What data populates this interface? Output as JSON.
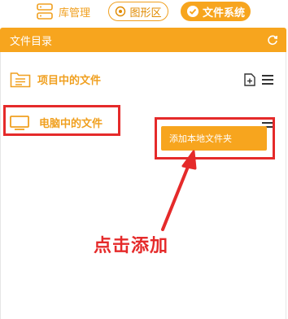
{
  "tabs": {
    "library": "库管理",
    "shapes": "图形区",
    "filesystem": "文件系统"
  },
  "header": {
    "title": "文件目录"
  },
  "rows": {
    "project": "项目中的文件",
    "computer": "电脑中的文件"
  },
  "menu": {
    "add_local_folder": "添加本地文件夹"
  },
  "annotation": "点击添加",
  "colors": {
    "accent": "#f7a51e",
    "highlight": "#e52a2a"
  }
}
